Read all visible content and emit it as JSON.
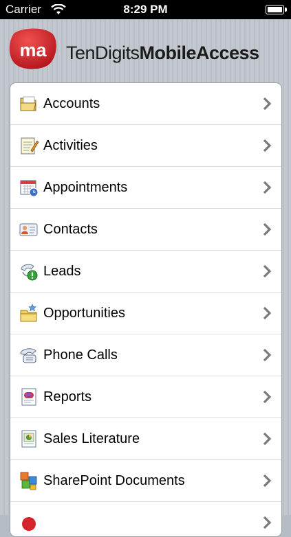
{
  "status_bar": {
    "carrier": "Carrier",
    "time": "8:29 PM"
  },
  "header": {
    "logo_mark": "ma",
    "brand_light": "TenDigits",
    "brand_bold": "MobileAccess",
    "brand_color": "#d6242c"
  },
  "menu": {
    "items": [
      {
        "label": "Accounts",
        "icon": "folder-icon"
      },
      {
        "label": "Activities",
        "icon": "notepad-icon"
      },
      {
        "label": "Appointments",
        "icon": "calendar-icon"
      },
      {
        "label": "Contacts",
        "icon": "contact-card-icon"
      },
      {
        "label": "Leads",
        "icon": "lead-phone-icon"
      },
      {
        "label": "Opportunities",
        "icon": "opportunity-folder-icon"
      },
      {
        "label": "Phone Calls",
        "icon": "phone-icon"
      },
      {
        "label": "Reports",
        "icon": "report-icon"
      },
      {
        "label": "Sales Literature",
        "icon": "literature-icon"
      },
      {
        "label": "SharePoint Documents",
        "icon": "sharepoint-icon"
      }
    ]
  }
}
